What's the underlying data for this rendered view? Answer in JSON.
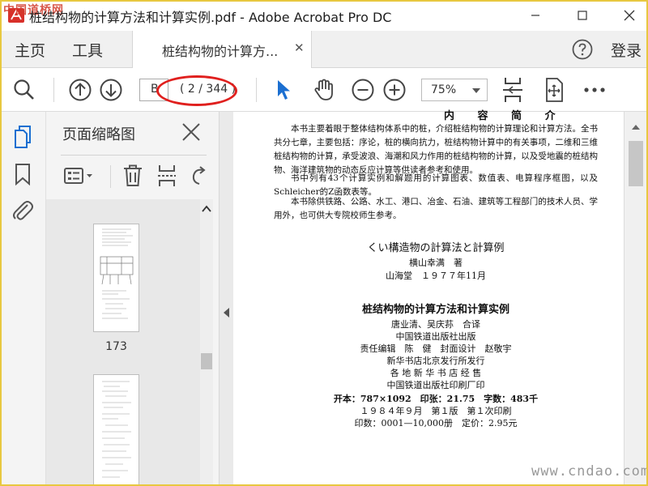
{
  "window": {
    "title": "桩结构物的计算方法和计算实例.pdf - Adobe Acrobat Pro DC",
    "watermark_top": "中国道桥网",
    "watermark_bottom": "www.cndao.com"
  },
  "tabs": {
    "home": "主页",
    "tools": "工具",
    "document": "桩结构物的计算方...",
    "login": "登录"
  },
  "toolbar": {
    "page_input": "B",
    "page_count": "( 2 / 344 )",
    "zoom": "75%"
  },
  "panel": {
    "title": "页面缩略图",
    "thumbnails": [
      {
        "label": "173"
      },
      {
        "label": ""
      }
    ]
  },
  "document": {
    "heading": "内 容 简 介",
    "paragraphs": [
      "本书主要着眼于整体结构体系中的桩，介绍桩结构物的计算理论和计算方法。全书共分七章，主要包括：序论，桩的横向抗力，桩结构物计算中的有关事项，二维和三维桩结构物的计算，承受波浪、海潮和风力作用的桩结构物的计算，以及受地震的桩结构物、海洋建筑物的动态反应计算等供读者参考和使用。",
      "书中列有43个计算实例和解题用的计算图表、数值表、电算程序框图，以及Schleicher的Z函数表等。",
      "本书除供铁路、公路、水工、港口、冶金、石油、建筑等工程部门的技术人员、学用外，也可供大专院校师生参考。"
    ],
    "jp_title": "くい構造物の計算法と計算例",
    "jp_author": "横山幸满　著",
    "jp_publisher": "山海堂　１９７７年11月",
    "cn_title": "桩结构物的计算方法和计算实例",
    "translators": "唐业清、吴庆荪　合译",
    "publisher": "中国铁道出版社出版",
    "editor": "责任编辑　陈　健　封面设计　赵敬宇",
    "distributor1": "新华书店北京发行所发行",
    "distributor2": "各 地 新 华 书 店 经 售",
    "printer": "中国铁道出版社印刷厂印",
    "specs": "开本：787×1092　印张：21.75　字数：483千",
    "edition": "１９８４年９月　第１版　第１次印刷",
    "print_run": "印数：0001—10,000册　定价：2.95元"
  }
}
